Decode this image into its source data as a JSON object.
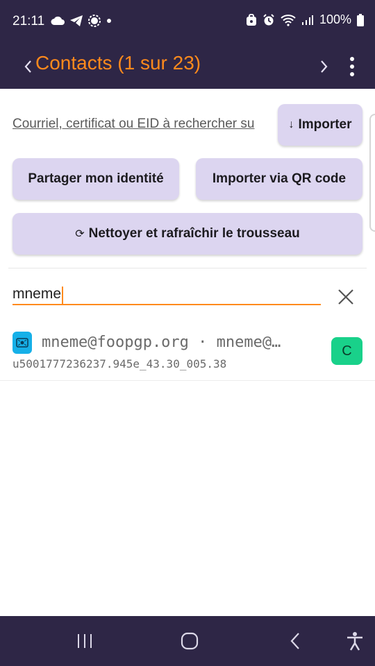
{
  "status_bar": {
    "time": "21:11",
    "battery": "100%",
    "icons": [
      "cloud-icon",
      "telegram-icon",
      "signal-app-icon",
      "dot-icon",
      "vpn-icon",
      "alarm-icon",
      "wifi-icon",
      "cell-signal-icon",
      "battery-icon"
    ]
  },
  "app_bar": {
    "title": "Contacts (1 sur 23)",
    "back_icon": "chevron-left-icon",
    "forward_icon": "chevron-right-icon",
    "menu_icon": "more-vert-icon"
  },
  "toolbar": {
    "search_link": "Courriel, certificat ou EID à rechercher su",
    "import_label": "Importer",
    "import_glyph": "↓",
    "share_label": "Partager mon identité",
    "qr_label": "Importer via QR code",
    "clean_label": "Nettoyer et rafraîchir le trousseau",
    "clean_glyph": "⟳"
  },
  "search": {
    "value": "mneme",
    "clear_icon": "close-icon"
  },
  "results": [
    {
      "line1": "mneme@foopgp.org  ·  mneme@…",
      "line2": "u5001777236237.945e_43.30_005.38",
      "badge": "C"
    }
  ],
  "nav": {
    "recents_icon": "recents-icon",
    "home_icon": "home-icon",
    "back_icon": "back-icon",
    "accessibility_icon": "accessibility-icon"
  },
  "colors": {
    "bar_bg": "#2e2646",
    "accent": "#ff8a1c",
    "button_bg": "#dcd5f0",
    "badge_bg": "#19d18a",
    "avatar_bg": "#16b0e8"
  }
}
